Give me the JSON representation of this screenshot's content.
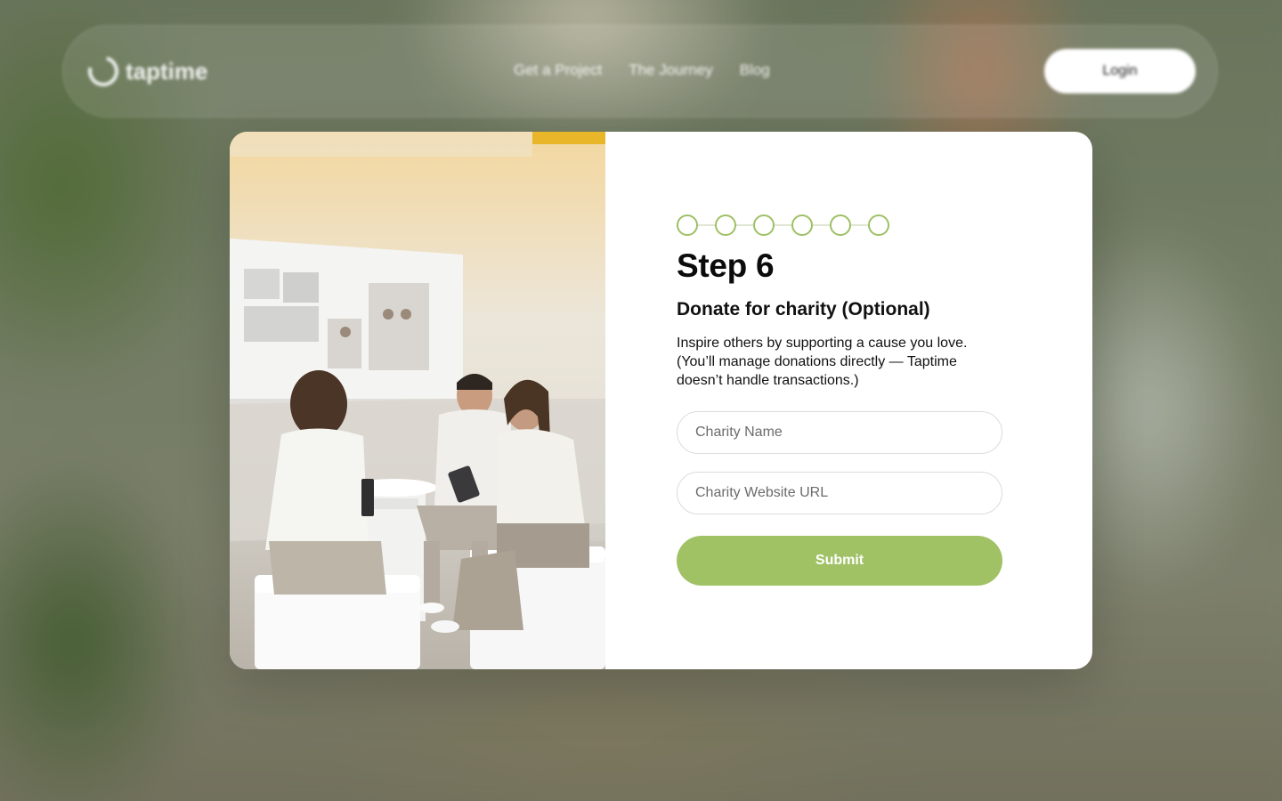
{
  "brand": {
    "name": "taptime"
  },
  "nav": {
    "links": [
      "Get a Project",
      "The Journey",
      "Blog"
    ],
    "login_label": "Login"
  },
  "form": {
    "steps_count": 6,
    "title": "Step 6",
    "subtitle": "Donate for charity (Optional)",
    "description": "Inspire others by supporting a cause you love. (You’ll manage donations directly — Taptime doesn’t handle transactions.)",
    "fields": {
      "charity_name": {
        "placeholder": "Charity Name",
        "value": ""
      },
      "charity_url": {
        "placeholder": "Charity Website URL",
        "value": ""
      }
    },
    "submit_label": "Submit"
  },
  "colors": {
    "accent": "#a0c265",
    "step_ring": "#9ec064",
    "title_text": "#0b0b0b"
  },
  "icons": {
    "logo": "taptime-logo-icon"
  }
}
